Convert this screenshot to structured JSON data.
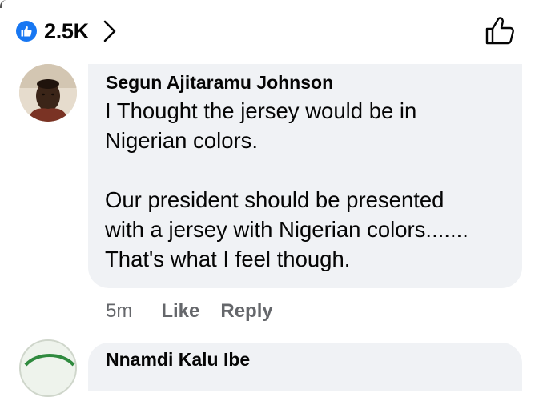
{
  "reactions": {
    "icon": "like-badge-icon",
    "count": "2.5K",
    "accent": "#1877f2"
  },
  "comment": {
    "author": "Segun Ajitaramu Johnson",
    "paragraphs": [
      "I  Thought the jersey would be in\nNigerian colors.",
      "Our president should be presented\nwith a jersey with Nigerian colors.......\nThat's what I feel though."
    ],
    "time": "5m",
    "like_label": "Like",
    "reply_label": "Reply",
    "bubble_color": "#f0f2f5",
    "meta_color": "#65676b"
  },
  "next_comment": {
    "author": "Nnamdi Kalu Ibe"
  }
}
